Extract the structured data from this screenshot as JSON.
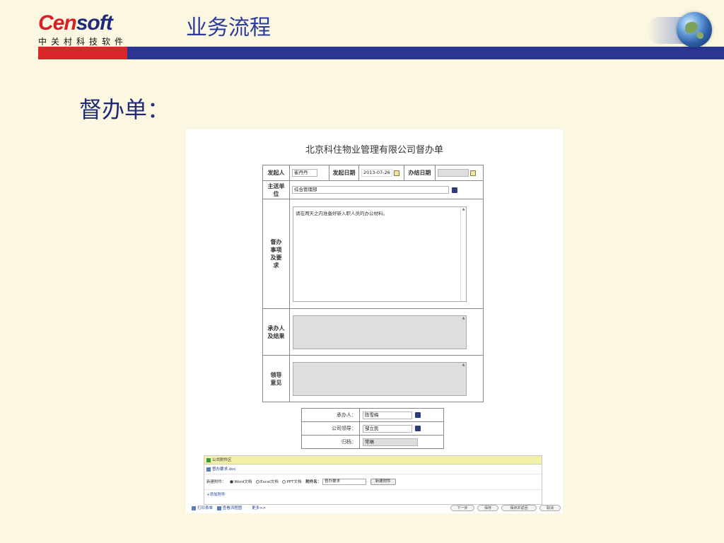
{
  "header": {
    "logo_part1": "Cen",
    "logo_part2": "soft",
    "logo_subtitle": "中关村科技软件",
    "title": "业务流程"
  },
  "section_title": "督办单：",
  "form": {
    "title": "北京科住物业管理有限公司督办单",
    "initiator_label": "发起人",
    "initiator_value": "崔丹丹",
    "start_date_label": "发起日期",
    "start_date_value": "2013-07-26",
    "done_date_label": "办结日期",
    "done_date_value": "",
    "main_unit_label": "主送单位",
    "main_unit_value": "综合管理部",
    "matter_label": "督办事项及要求",
    "matter_value": "请在两天之内准备好新入职人员的办公材料。",
    "handler_result_label": "承办人及结果",
    "leader_opinion_label": "领导意见"
  },
  "sign": {
    "handler_label": "承办人：",
    "handler_value": "陈雪梅",
    "company_leader_label": "公司领导：",
    "company_leader_value": "邹立民",
    "archive_label": "归档：",
    "archive_value": "常琳"
  },
  "attachments": {
    "header": "公共附件区",
    "file_name": "督办要求.doc",
    "new_attach_label": "新建附件：",
    "opt_word": "Word文档",
    "opt_excel": "Excel文档",
    "opt_ppt": "PPT文档",
    "attach_name_label": "附件名：",
    "attach_name_value": "督办要求",
    "new_attach_button": "新建附件",
    "add_attach_link": "添加附件"
  },
  "bottom": {
    "print_link": "打印表单",
    "view_flow_link": "查看流程图",
    "more_link": "更多>>",
    "next_button": "下一步",
    "save_button": "保存",
    "save_return_button": "保存并返回",
    "cancel_button": "取消"
  },
  "colors": {
    "background": "#fbf7e1",
    "title_blue": "#2b3a9e",
    "bar_red": "#d9262b",
    "bar_blue": "#2b3592"
  }
}
